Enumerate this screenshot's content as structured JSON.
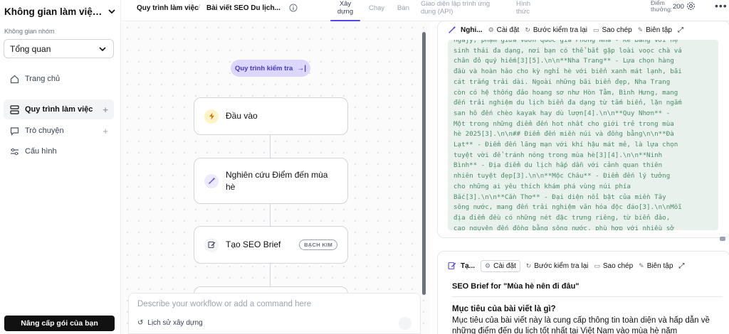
{
  "sidebar": {
    "workspace_title": "Không gian làm việc c...",
    "group_label": "Không gian nhóm",
    "selected_group": "Tổng quan",
    "items": [
      {
        "label": "Trang chủ"
      },
      {
        "label": "Quy trình làm việc"
      },
      {
        "label": "Trò chuyện"
      },
      {
        "label": "Cấu hình"
      }
    ],
    "upgrade_label": "Nâng cấp gói của bạn"
  },
  "header": {
    "breadcrumb_1": "Quy trình làm việc",
    "breadcrumb_sep": "/",
    "breadcrumb_2": "Bài viết SEO Du lịch...",
    "tabs": [
      {
        "label": "Xây\ndựng"
      },
      {
        "label": "Chạy"
      },
      {
        "label": "Bàn"
      },
      {
        "label": "Giao diện lập trình ứng\ndụng (API)"
      },
      {
        "label": "Hình\nthức"
      }
    ],
    "points_label": "Điểm\nthưởng:",
    "points_value": "200"
  },
  "canvas": {
    "workflow_pill": "Quy trình kiểm tra",
    "nodes": [
      {
        "label": "Đầu vào",
        "icon": "bolt-icon"
      },
      {
        "label": "Nghiên cứu Điểm đến mùa\nhè",
        "icon": "wand-icon"
      },
      {
        "label": "Tạo SEO Brief",
        "icon": "edit-icon",
        "badge": "BẠCH KIM"
      }
    ],
    "command_placeholder": "Describe your workflow or add a command here",
    "history_label": "Lịch sử xây dựng"
  },
  "output_panel": {
    "card1": {
      "title": "Nghi...",
      "buttons": {
        "settings": "Cài đặt",
        "retest": "Bước kiểm tra lại",
        "copy": "Sao chép",
        "edit": "Biên tập"
      },
      "code": "ngajy, phạm giữa vườn quốc gia Phong Nha - Kẻ Bàng với hệ\nsinh thái đa dạng, nơi bạn có thể bắt gặp loài voọc chà vá\nchân đỏ quý hiếm[3][5].\\n\\n**Nha Trang** - Lựa chọn hàng\nđầu và hoàn hảo cho kỳ nghỉ hè với biển xanh mát lạnh, bãi\ncát trắng trải dài. Ngoài những bãi biển đẹp, Nha Trang\ncòn có hệ thống đảo hoang sơ như Hòn Tằm, Bình Hưng, mang\nđến trải nghiệm du lịch biển đa dạng từ tắm biển, lặn ngắm\nsan hô đến chèo kayak hay dù lượn[4].\\n\\n**Quy Nhơn** -\nMột trong những điểm đến hot nhất cho giới trẻ trong mùa\nhè 2025[3].\\n\\n## Điểm đến miền núi và đồng bằng\\n\\n**Đà\nLạt** - Điểm đến lãng mạn với khí hậu mát mẻ, là lựa chọn\ntuyệt vời để tránh nóng trong mùa hè[3][4].\\n\\n**Ninh\nBình** - Địa điểm du lịch hấp dẫn với cảnh quan thiên\nnhiên tuyệt đẹp[3].\\n\\n**Mộc Châu** - Điểm đến lý tưởng\ncho những ai yêu thích khám phá vùng núi phía\nBắc[3].\\n\\n**Cần Thơ** - Đại diện nổi bật của miền Tây\nsông nước, mang đến trải nghiệm văn hóa độc đáo[3].\\n\\nMỗi\nđịa điểm đều có những nét đặc trưng riêng, từ biển đảo,\ncao nguyên đến đồng bằng sông nước, phù hợp với nhiều sở\nthích và nhu cầu khác nhau của du khách trong mùa hè."
    },
    "card2": {
      "title": "Tạ...",
      "buttons": {
        "settings": "Cài đặt",
        "retest": "Bước kiểm tra lại",
        "copy": "Sao chép",
        "edit": "Biên tập"
      },
      "heading": "SEO Brief for \"Mùa hè nên đi đâu\"",
      "subheading": "Mục tiêu của bài viết là gì?",
      "paragraph": "Mục tiêu của bài viết này là cung cấp thông tin toàn diện và hấp dẫn về những điểm đến du lịch tốt nhất tại Việt Nam vào mùa hè năm"
    }
  },
  "colors": {
    "accent": "#4f46e5",
    "pill_bg": "#ddd6fe",
    "code_bg": "#e9f1ec",
    "code_text": "#4b8a67"
  }
}
